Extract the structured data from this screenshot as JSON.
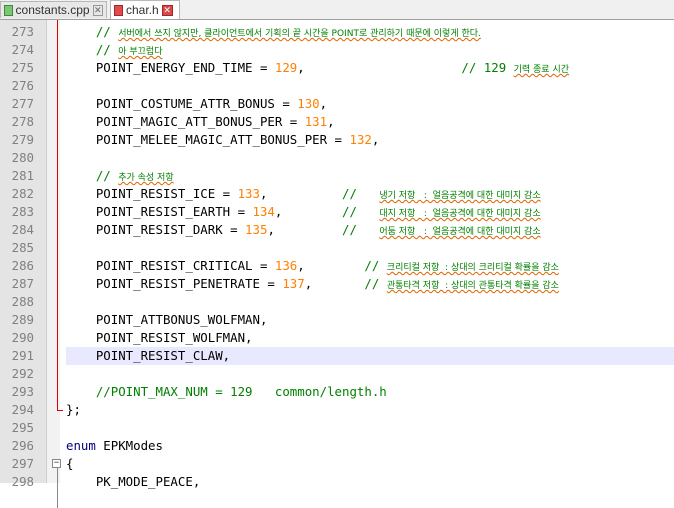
{
  "tabs": [
    {
      "label": "constants.cpp",
      "active": false
    },
    {
      "label": "char.h",
      "active": true
    }
  ],
  "lines": [
    {
      "n": "273",
      "segs": [
        {
          "t": "    // ",
          "c": "cmt"
        },
        {
          "t": "서버에서 쓰지 않지만, 클라이언트에서 기획의 끝 시간을 POINT로 관리하기 때문에 이렇게 한다.",
          "c": "kor"
        }
      ]
    },
    {
      "n": "274",
      "segs": [
        {
          "t": "    // ",
          "c": "cmt"
        },
        {
          "t": "아 부끄럽다",
          "c": "kor"
        }
      ]
    },
    {
      "n": "275",
      "segs": [
        {
          "t": "    POINT_ENERGY_END_TIME = "
        },
        {
          "t": "129",
          "c": "num"
        },
        {
          "t": ",                     "
        },
        {
          "t": "// 129 ",
          "c": "cmt"
        },
        {
          "t": "기력 종료 시간",
          "c": "kor"
        }
      ]
    },
    {
      "n": "276",
      "segs": []
    },
    {
      "n": "277",
      "segs": [
        {
          "t": "    POINT_COSTUME_ATTR_BONUS = "
        },
        {
          "t": "130",
          "c": "num"
        },
        {
          "t": ","
        }
      ]
    },
    {
      "n": "278",
      "segs": [
        {
          "t": "    POINT_MAGIC_ATT_BONUS_PER = "
        },
        {
          "t": "131",
          "c": "num"
        },
        {
          "t": ","
        }
      ]
    },
    {
      "n": "279",
      "segs": [
        {
          "t": "    POINT_MELEE_MAGIC_ATT_BONUS_PER = "
        },
        {
          "t": "132",
          "c": "num"
        },
        {
          "t": ","
        }
      ]
    },
    {
      "n": "280",
      "segs": []
    },
    {
      "n": "281",
      "segs": [
        {
          "t": "    // ",
          "c": "cmt"
        },
        {
          "t": "추가 속성 저항",
          "c": "kor"
        }
      ]
    },
    {
      "n": "282",
      "segs": [
        {
          "t": "    POINT_RESIST_ICE = "
        },
        {
          "t": "133",
          "c": "num"
        },
        {
          "t": ",          "
        },
        {
          "t": "//   ",
          "c": "cmt"
        },
        {
          "t": "냉기 저항   :  얼음공격에 대한 대미지 감소",
          "c": "kor"
        }
      ]
    },
    {
      "n": "283",
      "segs": [
        {
          "t": "    POINT_RESIST_EARTH = "
        },
        {
          "t": "134",
          "c": "num"
        },
        {
          "t": ",        "
        },
        {
          "t": "//   ",
          "c": "cmt"
        },
        {
          "t": "대지 저항   :  얼음공격에 대한 대미지 감소",
          "c": "kor"
        }
      ]
    },
    {
      "n": "284",
      "segs": [
        {
          "t": "    POINT_RESIST_DARK = "
        },
        {
          "t": "135",
          "c": "num"
        },
        {
          "t": ",         "
        },
        {
          "t": "//   ",
          "c": "cmt"
        },
        {
          "t": "어둠 저항   :  얼음공격에 대한 대미지 감소",
          "c": "kor"
        }
      ]
    },
    {
      "n": "285",
      "segs": []
    },
    {
      "n": "286",
      "segs": [
        {
          "t": "    POINT_RESIST_CRITICAL = "
        },
        {
          "t": "136",
          "c": "num"
        },
        {
          "t": ",        "
        },
        {
          "t": "// ",
          "c": "cmt"
        },
        {
          "t": "크리티컬 저항  : 상대의 크리티컬 확률을 감소",
          "c": "kor"
        }
      ]
    },
    {
      "n": "287",
      "segs": [
        {
          "t": "    POINT_RESIST_PENETRATE = "
        },
        {
          "t": "137",
          "c": "num"
        },
        {
          "t": ",       "
        },
        {
          "t": "// ",
          "c": "cmt"
        },
        {
          "t": "관통타격 저항  : 상대의 관통타격 확률을 감소",
          "c": "kor"
        }
      ]
    },
    {
      "n": "288",
      "segs": []
    },
    {
      "n": "289",
      "segs": [
        {
          "t": "    POINT_ATTBONUS_WOLFMAN,"
        }
      ]
    },
    {
      "n": "290",
      "segs": [
        {
          "t": "    POINT_RESIST_WOLFMAN,"
        }
      ]
    },
    {
      "n": "291",
      "segs": [
        {
          "t": "    POINT_RESIST_CLAW,"
        }
      ],
      "current": true
    },
    {
      "n": "292",
      "segs": []
    },
    {
      "n": "293",
      "segs": [
        {
          "t": "    //POINT_MAX_NUM = 129   common/length.h",
          "c": "cmt"
        }
      ]
    },
    {
      "n": "294",
      "segs": [
        {
          "t": "};"
        }
      ]
    },
    {
      "n": "295",
      "segs": []
    },
    {
      "n": "296",
      "segs": [
        {
          "t": "enum",
          "c": "kw"
        },
        {
          "t": " EPKModes"
        }
      ]
    },
    {
      "n": "297",
      "segs": [
        {
          "t": "{"
        }
      ]
    },
    {
      "n": "298",
      "segs": [
        {
          "t": "    PK_MODE_PEACE,"
        }
      ]
    }
  ],
  "colors": {
    "keyword": "#000080",
    "number": "#ff8000",
    "comment": "#008000",
    "current_line": "#e8e8ff"
  }
}
